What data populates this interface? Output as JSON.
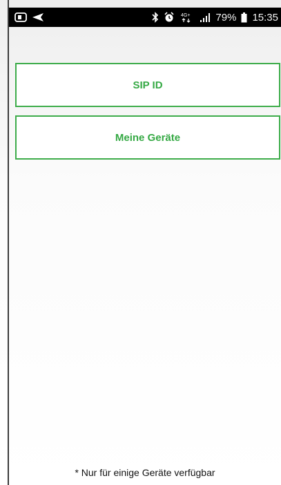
{
  "status_bar": {
    "battery_percent": "79%",
    "time": "15:35",
    "network_label": "4G+",
    "icons": [
      "app-notification-icon",
      "send-icon",
      "bluetooth-icon",
      "alarm-icon",
      "network-4g-icon",
      "signal-icon",
      "battery-icon"
    ]
  },
  "menu": {
    "sip_id_label": "SIP ID",
    "my_devices_label": "Meine Geräte"
  },
  "footnote": "* Nur für einige Geräte verfügbar",
  "colors": {
    "accent_green": "#3dac4a",
    "status_bar_bg": "#000000"
  }
}
